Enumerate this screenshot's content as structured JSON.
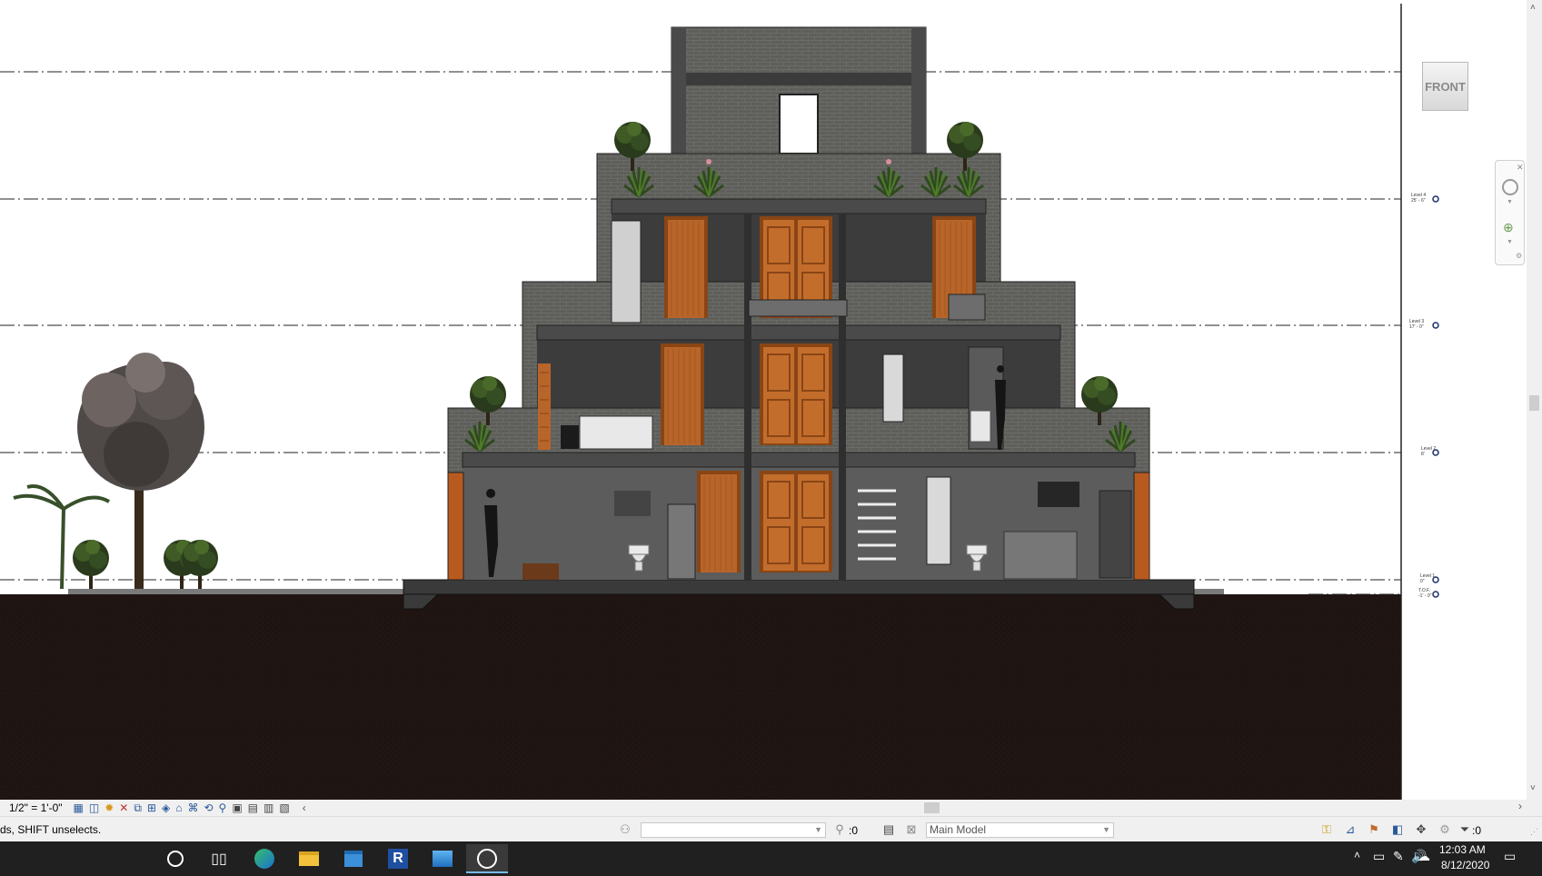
{
  "view": {
    "cube_face": "FRONT",
    "scale": "1/2\" = 1'-0\"",
    "levels": [
      {
        "name": "Level 4",
        "elevation": "25' - 6\""
      },
      {
        "name": "Level 3",
        "elevation": "17' - 0\""
      },
      {
        "name": "Level 2",
        "elevation": "8'"
      },
      {
        "name": "Level 1",
        "elevation": "0\""
      },
      {
        "name": "T.O.F.",
        "elevation": "-1' - 0\""
      }
    ]
  },
  "statusbar": {
    "message": "ds, SHIFT unselects.",
    "workset_value": "",
    "editable_count": ":0",
    "design_option": "Main Model",
    "filter_count": ":0"
  },
  "taskbar": {
    "time": "12:03 AM",
    "date": "8/12/2020",
    "apps": [
      "search",
      "task-view",
      "edge",
      "file-explorer",
      "store",
      "revit",
      "photos",
      "app"
    ]
  },
  "colors": {
    "ground": "#1e1411",
    "concrete": "#5b5b5a",
    "dark_interior": "#3c3c3c",
    "door": "#c06a2a",
    "taskbar": "#202020"
  }
}
